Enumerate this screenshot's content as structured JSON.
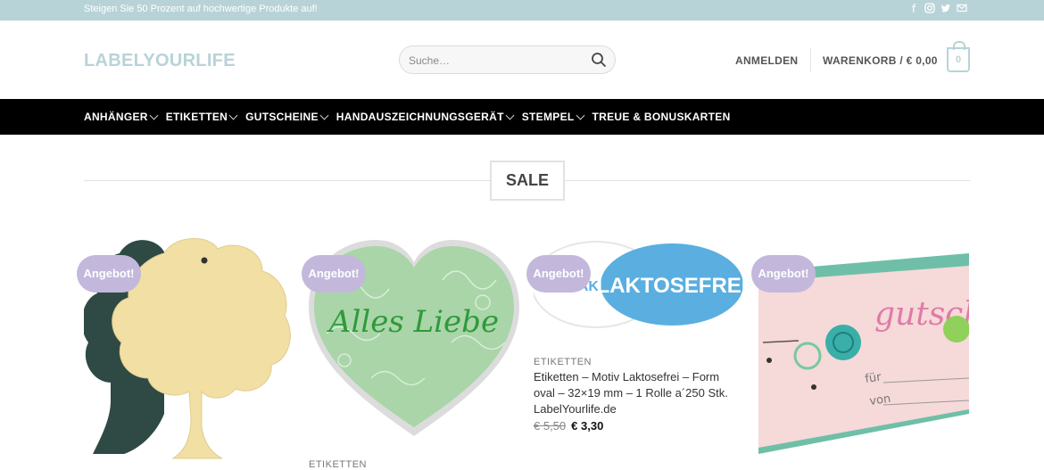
{
  "topbar": {
    "message": "Steigen Sie 50 Prozent auf hochwertige Produkte auf!",
    "social_icons": [
      "facebook-icon",
      "instagram-icon",
      "twitter-icon",
      "mail-icon"
    ]
  },
  "header": {
    "logo": "LABELYOURLIFE",
    "search_placeholder": "Suche…",
    "login_label": "ANMELDEN",
    "cart_label": "WARENKORB / € 0,00",
    "cart_count": "0"
  },
  "nav": {
    "items": [
      {
        "label": "ANHÄNGER",
        "dropdown": true
      },
      {
        "label": "ETIKETTEN",
        "dropdown": true
      },
      {
        "label": "GUTSCHEINE",
        "dropdown": true
      },
      {
        "label": "HANDAUSZEICHNUNGSGERÄT",
        "dropdown": true
      },
      {
        "label": "STEMPEL",
        "dropdown": true
      },
      {
        "label": "TREUE & BONUSKARTEN",
        "dropdown": false
      }
    ]
  },
  "section": {
    "title": "SALE"
  },
  "products": [
    {
      "badge": "Angebot!",
      "image": "tree-tag-image"
    },
    {
      "badge": "Angebot!",
      "image": "heart-alles-liebe-image",
      "category": "ETIKETTEN",
      "image_text": "Alles Liebe"
    },
    {
      "badge": "Angebot!",
      "image": "laktosefrei-label-image",
      "image_text": "LAKTOSEFREI",
      "category": "ETIKETTEN",
      "title": "Etiketten – Motiv Laktosefrei – Form oval – 32×19 mm – 1 Rolle a´250 Stk. LabelYourlife.de",
      "old_price": "€ 5,50",
      "new_price": "€ 3,30"
    },
    {
      "badge": "Angebot!",
      "image": "gutschein-card-image",
      "image_text": "gutsch",
      "image_text_fuer": "für",
      "image_text_von": "von"
    }
  ],
  "colors": {
    "topbar": "#b8d3d8",
    "nav": "#000000",
    "badge": "#c3b8dc"
  }
}
